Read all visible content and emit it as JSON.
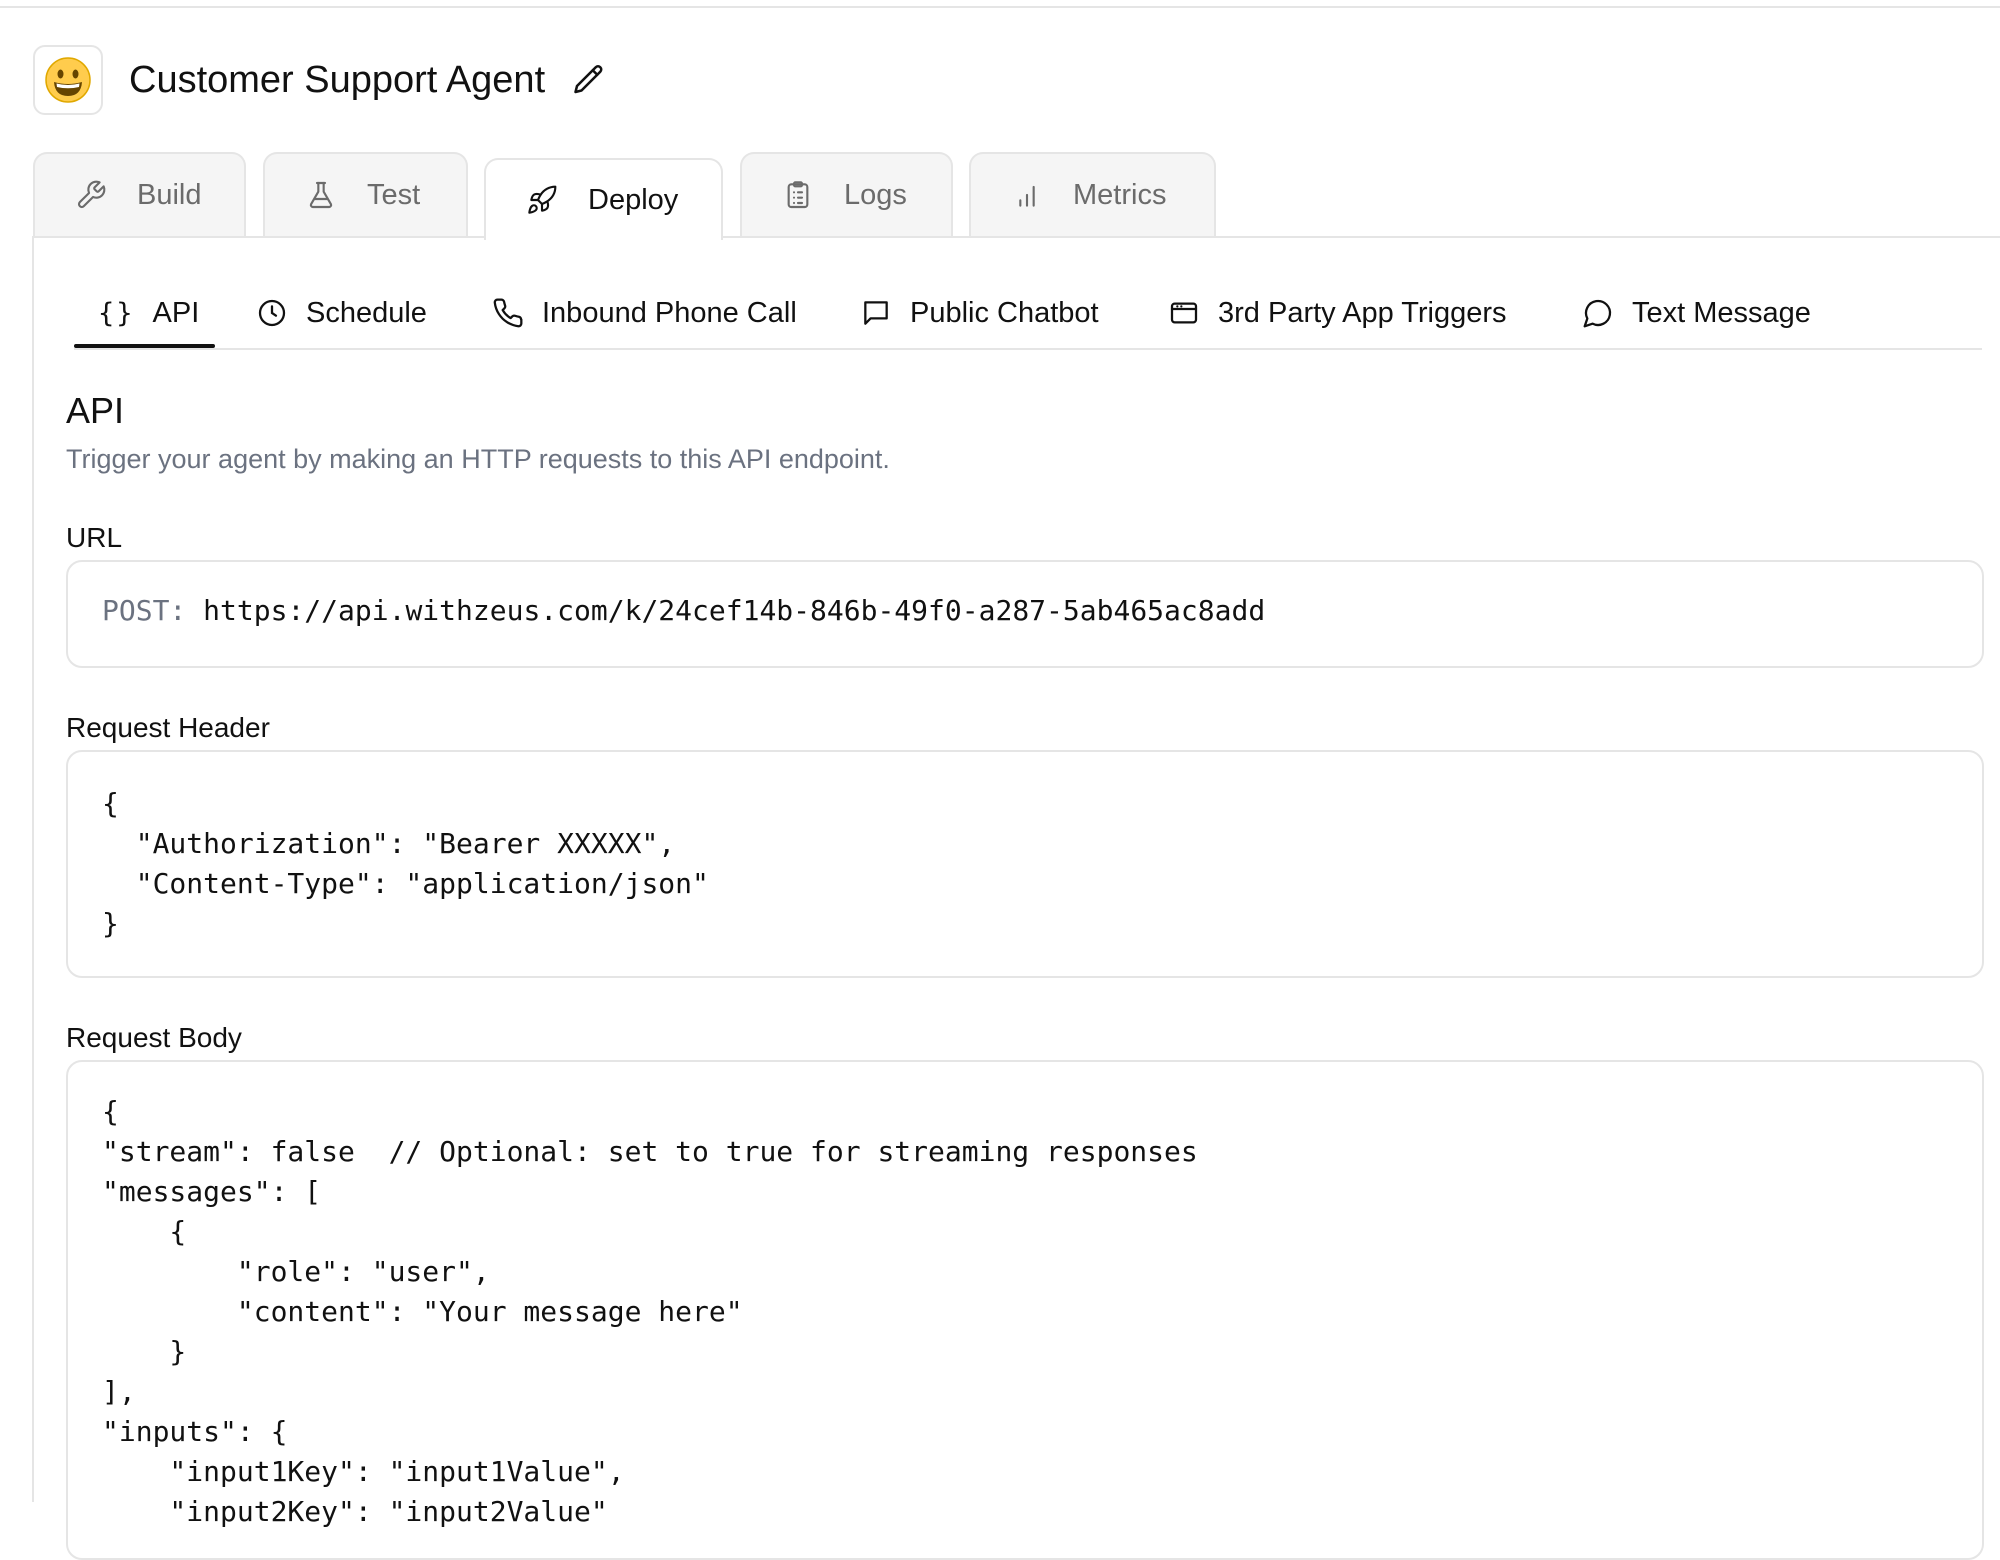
{
  "header": {
    "avatar_emoji": "😀",
    "agent_name": "Customer Support Agent"
  },
  "main_tabs": [
    {
      "id": "build",
      "label": "Build",
      "icon": "wrench-icon",
      "active": false
    },
    {
      "id": "test",
      "label": "Test",
      "icon": "flask-icon",
      "active": false
    },
    {
      "id": "deploy",
      "label": "Deploy",
      "icon": "rocket-icon",
      "active": true
    },
    {
      "id": "logs",
      "label": "Logs",
      "icon": "clipboard-icon",
      "active": false
    },
    {
      "id": "metrics",
      "label": "Metrics",
      "icon": "bar-chart-icon",
      "active": false
    }
  ],
  "sub_tabs": [
    {
      "id": "api",
      "label": "API",
      "icon_text": "{}",
      "icon": "braces-icon",
      "active": true
    },
    {
      "id": "schedule",
      "label": "Schedule",
      "icon": "clock-icon",
      "active": false
    },
    {
      "id": "inbound-phone-call",
      "label": "Inbound Phone Call",
      "icon": "phone-icon",
      "active": false
    },
    {
      "id": "public-chatbot",
      "label": "Public Chatbot",
      "icon": "chat-square-icon",
      "active": false
    },
    {
      "id": "third-party-app-triggers",
      "label": "3rd Party App Triggers",
      "icon": "app-window-icon",
      "active": false
    },
    {
      "id": "text-message",
      "label": "Text Message",
      "icon": "chat-bubble-icon",
      "active": false
    }
  ],
  "api_section": {
    "title": "API",
    "description": "Trigger your agent by making an HTTP requests to this API endpoint.",
    "url_label": "URL",
    "url_method": "POST:",
    "url": "https://api.withzeus.com/k/24cef14b-846b-49f0-a287-5ab465ac8add",
    "header_label": "Request Header",
    "header_code": "{\n  \"Authorization\": \"Bearer XXXXX\",\n  \"Content-Type\": \"application/json\"\n}",
    "body_label": "Request Body",
    "body_code": "{\n\"stream\": false  // Optional: set to true for streaming responses\n\"messages\": [\n    {\n        \"role\": \"user\",\n        \"content\": \"Your message here\"\n    }\n],\n\"inputs\": {\n    \"input1Key\": \"input1Value\",\n    \"input2Key\": \"input2Value\""
  }
}
